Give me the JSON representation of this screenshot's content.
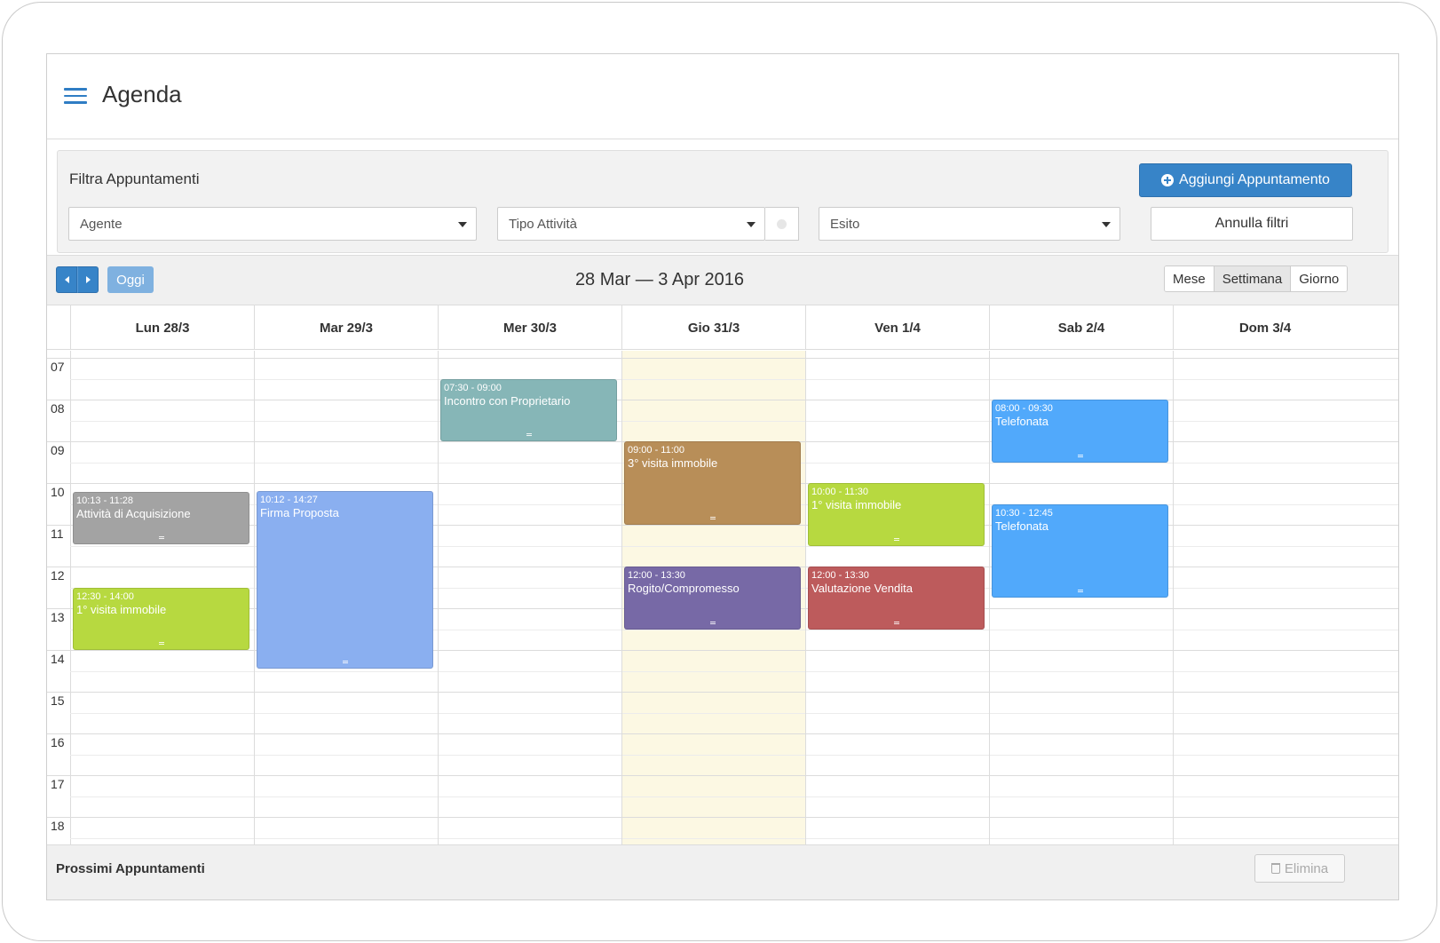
{
  "header": {
    "title": "Agenda"
  },
  "filters": {
    "title": "Filtra Appuntamenti",
    "add_button": "Aggiungi Appuntamento",
    "agent_placeholder": "Agente",
    "activity_placeholder": "Tipo Attività",
    "outcome_placeholder": "Esito",
    "reset_button": "Annulla filtri"
  },
  "toolbar": {
    "today_label": "Oggi",
    "range_title": "28 Mar — 3 Apr 2016",
    "views": [
      {
        "label": "Mese",
        "active": false
      },
      {
        "label": "Settimana",
        "active": true
      },
      {
        "label": "Giorno",
        "active": false
      }
    ]
  },
  "calendar": {
    "days": [
      {
        "label": "Lun 28/3",
        "today": false
      },
      {
        "label": "Mar 29/3",
        "today": false
      },
      {
        "label": "Mer 30/3",
        "today": false
      },
      {
        "label": "Gio 31/3",
        "today": true
      },
      {
        "label": "Ven 1/4",
        "today": false
      },
      {
        "label": "Sab 2/4",
        "today": false
      },
      {
        "label": "Dom 3/4",
        "today": false
      }
    ],
    "hours": [
      "07",
      "08",
      "09",
      "10",
      "11",
      "12",
      "13",
      "14",
      "15",
      "16",
      "17",
      "18"
    ],
    "events": [
      {
        "day": 0,
        "start": "10:13",
        "end": "11:28",
        "time_label": "10:13 - 11:28",
        "title": "Attività di Acquisizione",
        "color": "#a3a3a3"
      },
      {
        "day": 0,
        "start": "12:30",
        "end": "14:00",
        "time_label": "12:30 - 14:00",
        "title": "1° visita immobile",
        "color": "#b7d940"
      },
      {
        "day": 1,
        "start": "10:12",
        "end": "14:27",
        "time_label": "10:12 - 14:27",
        "title": "Firma Proposta",
        "color": "#8aaff0"
      },
      {
        "day": 2,
        "start": "07:30",
        "end": "09:00",
        "time_label": "07:30 - 09:00",
        "title": "Incontro con Proprietario",
        "color": "#86b6b7"
      },
      {
        "day": 3,
        "start": "09:00",
        "end": "11:00",
        "time_label": "09:00 - 11:00",
        "title": "3° visita immobile",
        "color": "#b88e58"
      },
      {
        "day": 3,
        "start": "12:00",
        "end": "13:30",
        "time_label": "12:00 - 13:30",
        "title": "Rogito/Compromesso",
        "color": "#7769a6"
      },
      {
        "day": 4,
        "start": "10:00",
        "end": "11:30",
        "time_label": "10:00 - 11:30",
        "title": "1° visita immobile",
        "color": "#b7d940"
      },
      {
        "day": 4,
        "start": "12:00",
        "end": "13:30",
        "time_label": "12:00 - 13:30",
        "title": "Valutazione Vendita",
        "color": "#bd5b5c"
      },
      {
        "day": 5,
        "start": "08:00",
        "end": "09:30",
        "time_label": "08:00 - 09:30",
        "title": "Telefonata",
        "color": "#51a9fb"
      },
      {
        "day": 5,
        "start": "10:30",
        "end": "12:45",
        "time_label": "10:30 - 12:45",
        "title": "Telefonata",
        "color": "#51a9fb"
      }
    ]
  },
  "bottom": {
    "title": "Prossimi Appuntamenti",
    "delete_button": "Elimina"
  },
  "colors": {
    "primary": "#3784c8",
    "today_highlight": "#fcf8e3"
  },
  "icons": [
    "menu-icon",
    "plus-circle-icon",
    "chevron-down-icon",
    "chevron-left-icon",
    "chevron-right-icon",
    "trash-icon"
  ]
}
